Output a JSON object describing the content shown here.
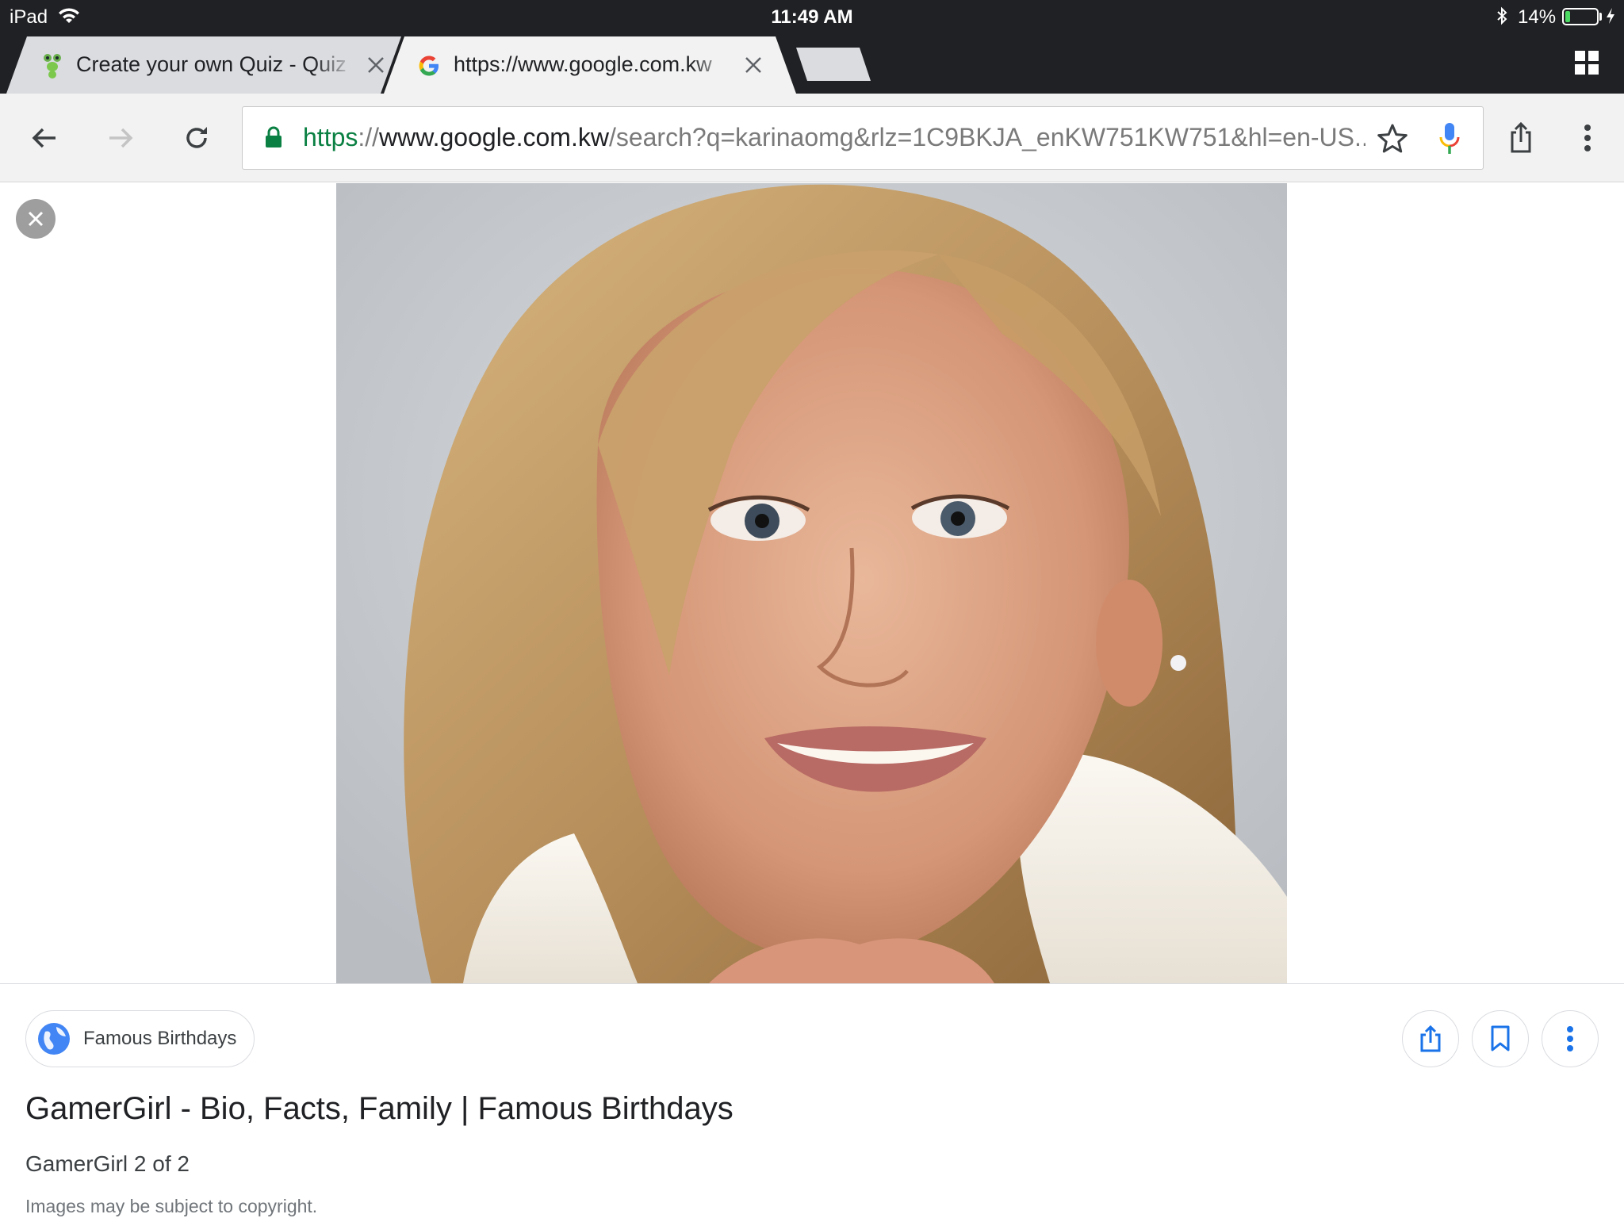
{
  "status_bar": {
    "device": "iPad",
    "time": "11:49 AM",
    "battery_text": "14%",
    "battery_level": 0.14,
    "icons": [
      "wifi-icon",
      "bluetooth-icon",
      "battery-icon",
      "charging-bolt-icon"
    ]
  },
  "tabs": [
    {
      "title": "Create your own Quiz - Quiz",
      "favicon": "quiz-mascot-favicon",
      "active": false
    },
    {
      "title": "https://www.google.com.kw",
      "favicon": "google-g-favicon",
      "active": true
    }
  ],
  "toolbar": {
    "url_scheme": "https",
    "url_separator": "://",
    "url_host": "www.google.com.kw",
    "url_path": "/search?q=karinaomg&rlz=1C9BKJA_enKW751KW751&hl=en-US...",
    "icons": [
      "back-icon",
      "forward-icon",
      "reload-icon",
      "lock-icon",
      "star-icon",
      "mic-icon",
      "share-icon",
      "more-vert-icon"
    ]
  },
  "result": {
    "source": "Famous Birthdays",
    "title": "GamerGirl - Bio, Facts, Family | Famous Birthdays",
    "subtitle": "GamerGirl 2 of 2",
    "note": "Images may be subject to copyright."
  },
  "colors": {
    "chrome_dark": "#202124",
    "toolbar_bg": "#f2f2f2",
    "secure_green": "#0b8043",
    "google_blue": "#4285f4",
    "google_red": "#ea4335",
    "google_yellow": "#fbbc05",
    "google_green": "#34a853",
    "battery_green": "#4cd964"
  }
}
